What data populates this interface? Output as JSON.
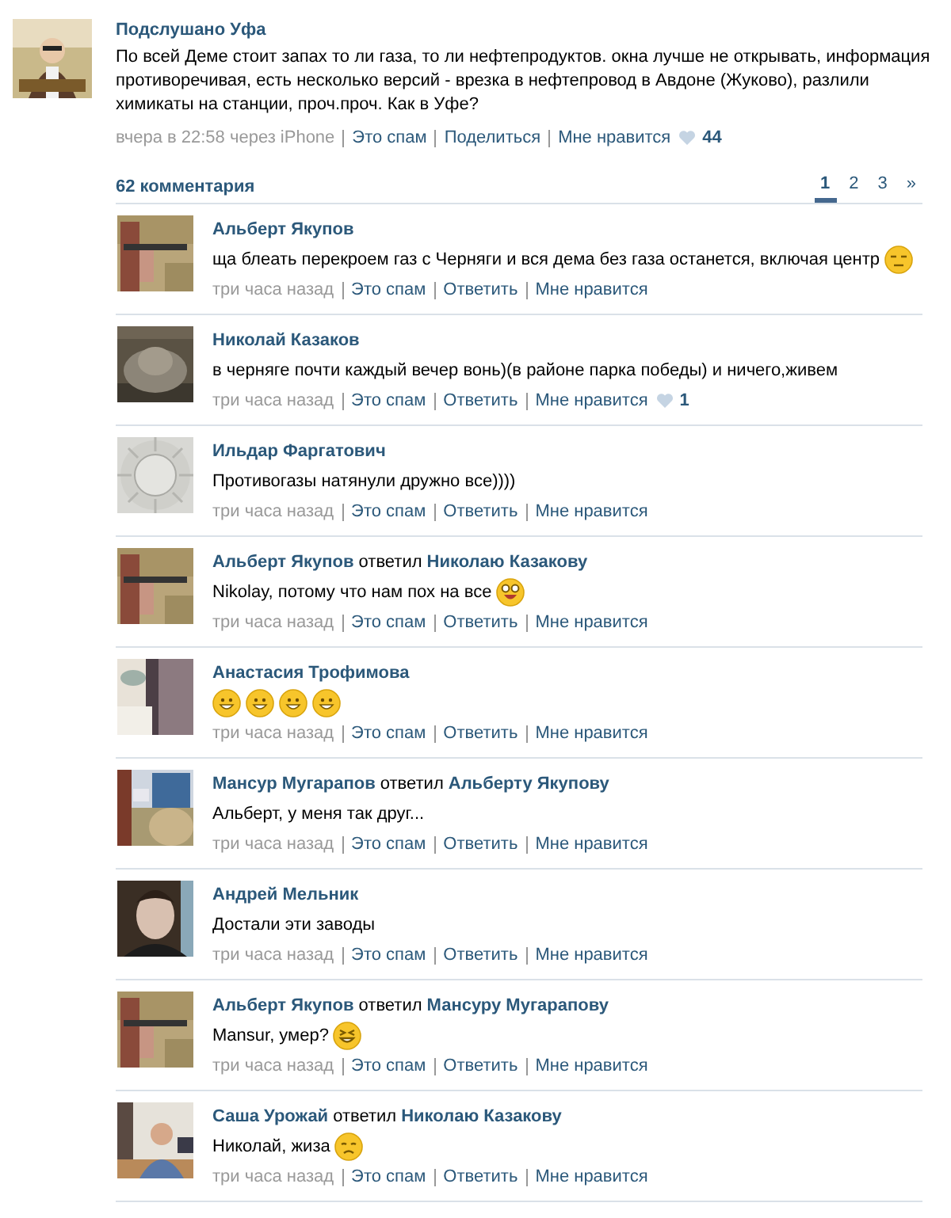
{
  "post": {
    "author": "Подслушано Уфа",
    "avatar": {
      "kind": "picture"
    },
    "text": "По всей Деме стоит запах то ли газа, то ли нефтепродуктов. окна лучше не открывать, информация противоречивая, есть несколько версий - врезка в нефтепровод в Авдоне (Жуково), разлили химикаты на станции, проч.проч. Как в Уфе?",
    "time": "вчера в 22:58 через iPhone",
    "actions": [
      "Это спам",
      "Поделиться",
      "Мне нравится"
    ],
    "likes": "44"
  },
  "comments_header": {
    "count": "62 комментария",
    "pages": [
      {
        "label": "1",
        "selected": true
      },
      {
        "label": "2",
        "selected": false
      },
      {
        "label": "3",
        "selected": false
      },
      {
        "label": "»",
        "selected": false
      }
    ]
  },
  "comments": [
    {
      "author": "Альберт Якупов",
      "avatar": {
        "kind": "picture"
      },
      "text": "ща блеать перекроем газ с Черняги и вся дема без газа останется, включая центр",
      "emoji": [
        {
          "kind": "smirk"
        }
      ],
      "time": "три часа назад",
      "actions": [
        "Это спам",
        "Ответить",
        "Мне нравится"
      ]
    },
    {
      "author": "Николай Казаков",
      "avatar": {
        "kind": "picture"
      },
      "text": "в черняге почти каждый вечер вонь)(в районе парка победы) и ничего,живем",
      "time": "три часа назад",
      "actions": [
        "Это спам",
        "Ответить",
        "Мне нравится"
      ],
      "likes": "1"
    },
    {
      "author": "Ильдар Фаргатович",
      "avatar": {
        "kind": "picture"
      },
      "text": "Противогазы натянули дружно все))))",
      "time": "три часа назад",
      "actions": [
        "Это спам",
        "Ответить",
        "Мне нравится"
      ]
    },
    {
      "author": "Альберт Якупов",
      "reply_word": "ответил",
      "reply_to": "Николаю Казакову",
      "avatar": {
        "kind": "picture"
      },
      "text": "Nikolay, потому что нам пох на все",
      "emoji": [
        {
          "kind": "laugh"
        }
      ],
      "time": "три часа назад",
      "actions": [
        "Это спам",
        "Ответить",
        "Мне нравится"
      ]
    },
    {
      "author": "Анастасия Трофимова",
      "avatar": {
        "kind": "picture"
      },
      "emoji": [
        {
          "kind": "grin"
        },
        {
          "kind": "grin"
        },
        {
          "kind": "grin"
        },
        {
          "kind": "grin"
        }
      ],
      "time": "три часа назад",
      "actions": [
        "Это спам",
        "Ответить",
        "Мне нравится"
      ]
    },
    {
      "author": "Мансур Мугарапов",
      "reply_word": "ответил",
      "reply_to": "Альберту Якупову",
      "avatar": {
        "kind": "picture"
      },
      "text": "Альберт, у меня так друг...",
      "time": "три часа назад",
      "actions": [
        "Это спам",
        "Ответить",
        "Мне нравится"
      ]
    },
    {
      "author": "Андрей Мельник",
      "avatar": {
        "kind": "picture"
      },
      "text": "Достали эти заводы",
      "time": "три часа назад",
      "actions": [
        "Это спам",
        "Ответить",
        "Мне нравится"
      ]
    },
    {
      "author": "Альберт Якупов",
      "reply_word": "ответил",
      "reply_to": "Мансуру Мугарапову",
      "avatar": {
        "kind": "picture"
      },
      "text": "Mansur, умер?",
      "emoji": [
        {
          "kind": "squint"
        }
      ],
      "time": "три часа назад",
      "actions": [
        "Это спам",
        "Ответить",
        "Мне нравится"
      ]
    },
    {
      "author": "Саша Урожай",
      "reply_word": "ответил",
      "reply_to": "Николаю Казакову",
      "avatar": {
        "kind": "picture"
      },
      "text": "Николай, жиза",
      "emoji": [
        {
          "kind": "sad"
        }
      ],
      "time": "три часа назад",
      "actions": [
        "Это спам",
        "Ответить",
        "Мне нравится"
      ]
    }
  ]
}
